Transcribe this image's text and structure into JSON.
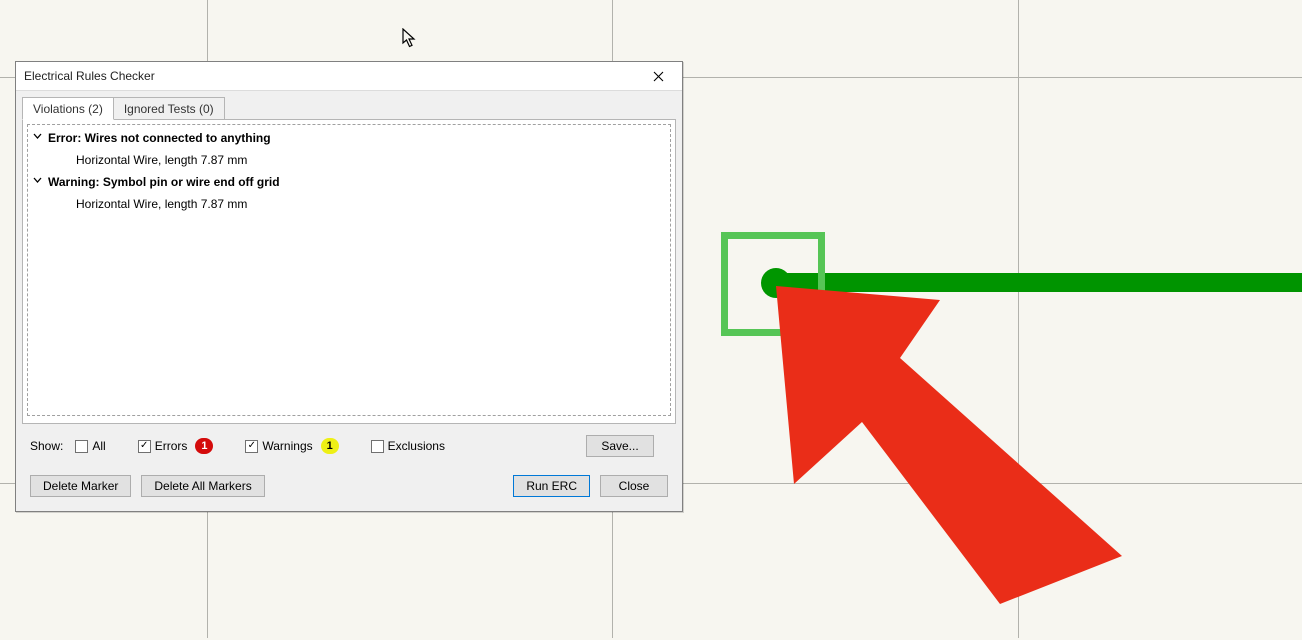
{
  "dialog": {
    "title": "Electrical Rules Checker"
  },
  "tabs": {
    "violations": "Violations (2)",
    "ignored": "Ignored Tests (0)"
  },
  "violations": [
    {
      "label": "Error: Wires not connected to anything",
      "items": [
        "Horizontal Wire, length 7.87 mm"
      ]
    },
    {
      "label": "Warning: Symbol pin or wire end off grid",
      "items": [
        "Horizontal Wire, length 7.87 mm"
      ]
    }
  ],
  "show": {
    "label": "Show:",
    "all": "All",
    "errors": "Errors",
    "errors_count": "1",
    "warnings": "Warnings",
    "warnings_count": "1",
    "exclusions": "Exclusions"
  },
  "buttons": {
    "save": "Save...",
    "delete_marker": "Delete Marker",
    "delete_all": "Delete All Markers",
    "run_erc": "Run ERC",
    "close": "Close"
  }
}
